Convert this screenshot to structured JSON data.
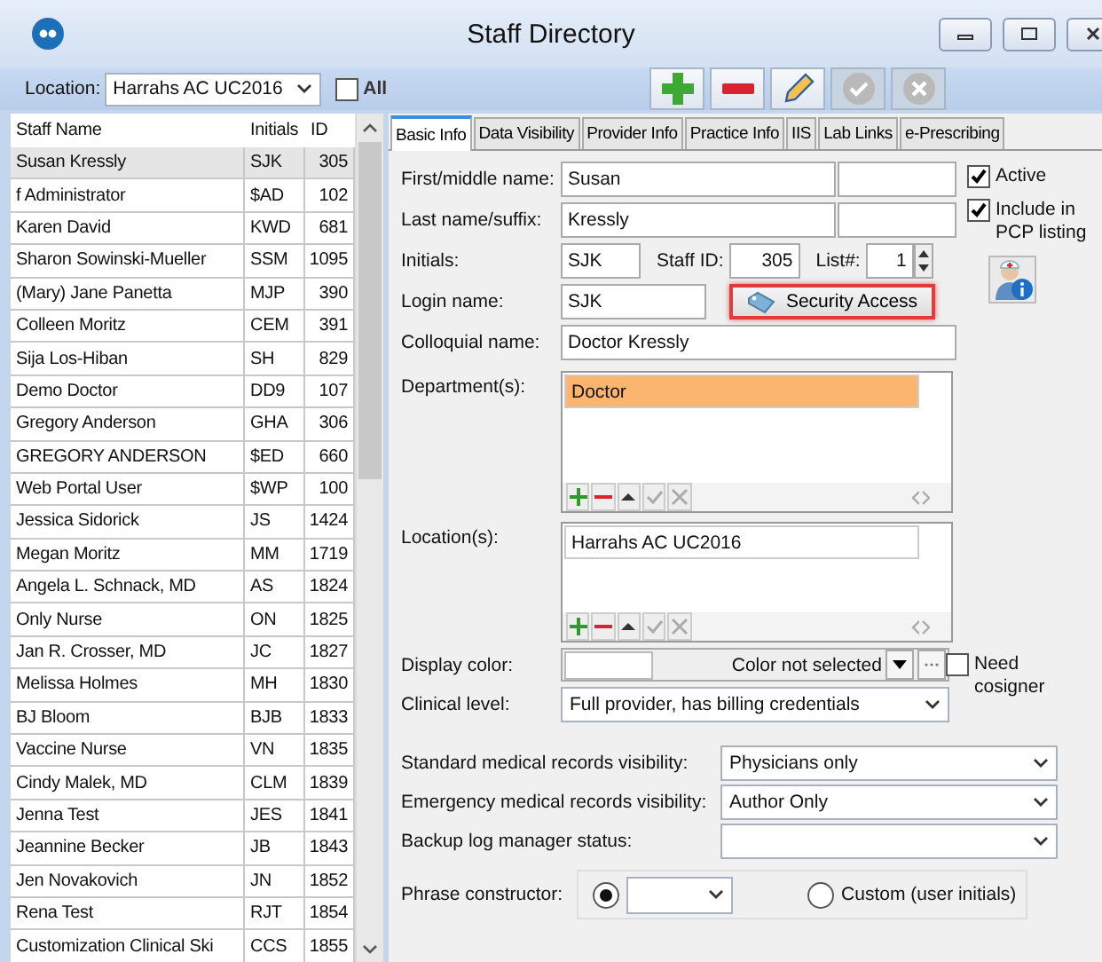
{
  "window": {
    "title": "Staff Directory"
  },
  "toolbar": {
    "location_label": "Location:",
    "location": "Harrahs AC UC2016",
    "all_label": "All",
    "all_checked": false,
    "buttons": [
      {
        "kind": "add",
        "disabled": false
      },
      {
        "kind": "remove",
        "disabled": false
      },
      {
        "kind": "edit",
        "disabled": false
      },
      {
        "kind": "accept",
        "disabled": true
      },
      {
        "kind": "cancel",
        "disabled": true
      }
    ]
  },
  "staff_list": {
    "columns": [
      "Staff Name",
      "Initials",
      "ID"
    ],
    "rows": [
      {
        "name": "Susan Kressly",
        "initials": "SJK",
        "id": "305",
        "selected": true
      },
      {
        "name": "f Administrator",
        "initials": "$AD",
        "id": "102",
        "selected": false
      },
      {
        "name": "Karen David",
        "initials": "KWD",
        "id": "681",
        "selected": false
      },
      {
        "name": "Sharon Sowinski-Mueller",
        "initials": "SSM",
        "id": "1095",
        "selected": false
      },
      {
        "name": "(Mary) Jane Panetta",
        "initials": "MJP",
        "id": "390",
        "selected": false
      },
      {
        "name": "Colleen Moritz",
        "initials": "CEM",
        "id": "391",
        "selected": false
      },
      {
        "name": "Sija Los-Hiban",
        "initials": "SH",
        "id": "829",
        "selected": false
      },
      {
        "name": "Demo Doctor",
        "initials": "DD9",
        "id": "107",
        "selected": false
      },
      {
        "name": "Gregory Anderson",
        "initials": "GHA",
        "id": "306",
        "selected": false
      },
      {
        "name": "GREGORY ANDERSON",
        "initials": "$ED",
        "id": "660",
        "selected": false
      },
      {
        "name": "Web Portal User",
        "initials": "$WP",
        "id": "100",
        "selected": false
      },
      {
        "name": "Jessica Sidorick",
        "initials": "JS",
        "id": "1424",
        "selected": false
      },
      {
        "name": "Megan Moritz",
        "initials": "MM",
        "id": "1719",
        "selected": false
      },
      {
        "name": "Angela L. Schnack, MD",
        "initials": "AS",
        "id": "1824",
        "selected": false
      },
      {
        "name": "Only Nurse",
        "initials": "ON",
        "id": "1825",
        "selected": false
      },
      {
        "name": "Jan R. Crosser, MD",
        "initials": "JC",
        "id": "1827",
        "selected": false
      },
      {
        "name": "Melissa Holmes",
        "initials": "MH",
        "id": "1830",
        "selected": false
      },
      {
        "name": "BJ Bloom",
        "initials": "BJB",
        "id": "1833",
        "selected": false
      },
      {
        "name": "Vaccine Nurse",
        "initials": "VN",
        "id": "1835",
        "selected": false
      },
      {
        "name": "Cindy Malek, MD",
        "initials": "CLM",
        "id": "1839",
        "selected": false
      },
      {
        "name": "Jenna Test",
        "initials": "JES",
        "id": "1841",
        "selected": false
      },
      {
        "name": "Jeannine Becker",
        "initials": "JB",
        "id": "1843",
        "selected": false
      },
      {
        "name": "Jen Novakovich",
        "initials": "JN",
        "id": "1852",
        "selected": false
      },
      {
        "name": "Rena Test",
        "initials": "RJT",
        "id": "1854",
        "selected": false
      },
      {
        "name": "Customization Clinical Ski",
        "initials": "CCS",
        "id": "1855",
        "selected": false
      }
    ]
  },
  "tabs": [
    {
      "label": "Basic Info",
      "selected": true
    },
    {
      "label": "Data Visibility",
      "selected": false
    },
    {
      "label": "Provider Info",
      "selected": false
    },
    {
      "label": "Practice Info",
      "selected": false
    },
    {
      "label": "IIS",
      "selected": false
    },
    {
      "label": "Lab Links",
      "selected": false
    },
    {
      "label": "e-Prescribing",
      "selected": false
    }
  ],
  "form": {
    "first_name": {
      "label": "First/middle name:",
      "value": "Susan"
    },
    "last_name": {
      "label": "Last name/suffix:",
      "value": "Kressly"
    },
    "initials": {
      "label": "Initials:",
      "value": "SJK"
    },
    "staff_id": {
      "label": "Staff ID:",
      "value": "305"
    },
    "list_number": {
      "label": "List#:",
      "value": "1"
    },
    "login_name": {
      "label": "Login name:",
      "value": "SJK"
    },
    "security_button": {
      "label": "Security Access",
      "highlighted": true
    },
    "colloquial_name": {
      "label": "Colloquial name:",
      "value": "Doctor Kressly"
    },
    "departments": {
      "label": "Department(s):",
      "items": [
        {
          "text": "Doctor",
          "selected": true
        }
      ]
    },
    "locations": {
      "label": "Location(s):",
      "items": [
        {
          "text": "Harrahs AC UC2016",
          "selected": false
        }
      ]
    },
    "display_color": {
      "label": "Display color:",
      "value": "Color not selected"
    },
    "clinical_level": {
      "label": "Clinical level:",
      "value": "Full provider, has billing credentials"
    },
    "need_cosigner": {
      "label": "Need cosigner",
      "checked": false
    },
    "active": {
      "label": "Active",
      "checked": true
    },
    "pcp": {
      "label": "Include in PCP listing",
      "checked": true
    },
    "visibility": [
      {
        "label": "Standard medical records visibility:",
        "value": "Physicians only"
      },
      {
        "label": "Emergency medical records visibility:",
        "value": "Author Only"
      },
      {
        "label": "Backup log manager status:"
      }
    ],
    "phrase": {
      "label": "Phrase constructor:",
      "options": [
        {
          "kind": "dropdown",
          "selected": true
        },
        {
          "kind": "custom",
          "label": "Custom (user initials)",
          "selected": false
        }
      ]
    }
  }
}
